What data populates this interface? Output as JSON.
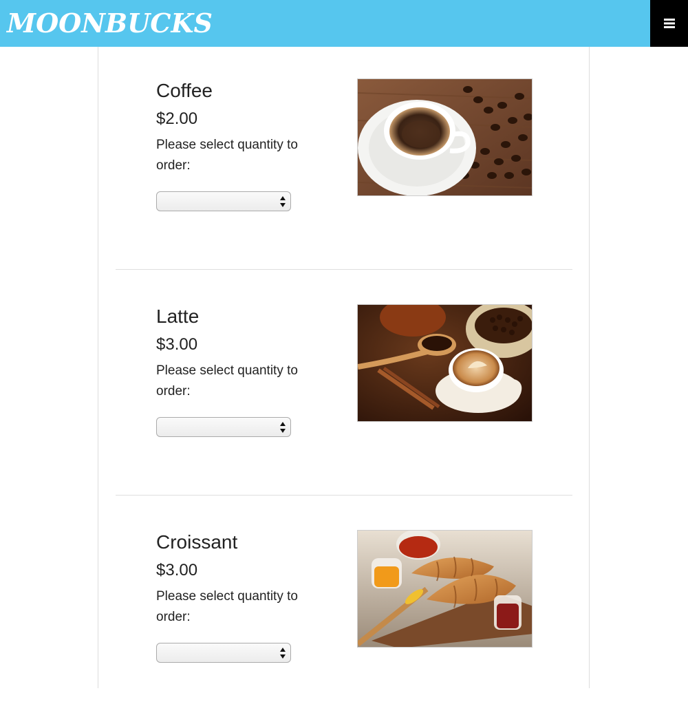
{
  "navbar": {
    "brand": "MOONBUCKS",
    "brand_color": "#56c6ee",
    "menu_icon": "hamburger-icon"
  },
  "products": [
    {
      "name": "Coffee",
      "price": "$2.00",
      "prompt": "Please select quantity to order:",
      "quantity_value": "",
      "image_icon": "coffee-photo"
    },
    {
      "name": "Latte",
      "price": "$3.00",
      "prompt": "Please select quantity to order:",
      "quantity_value": "",
      "image_icon": "latte-photo"
    },
    {
      "name": "Croissant",
      "price": "$3.00",
      "prompt": "Please select quantity to order:",
      "quantity_value": "",
      "image_icon": "croissant-photo"
    }
  ]
}
